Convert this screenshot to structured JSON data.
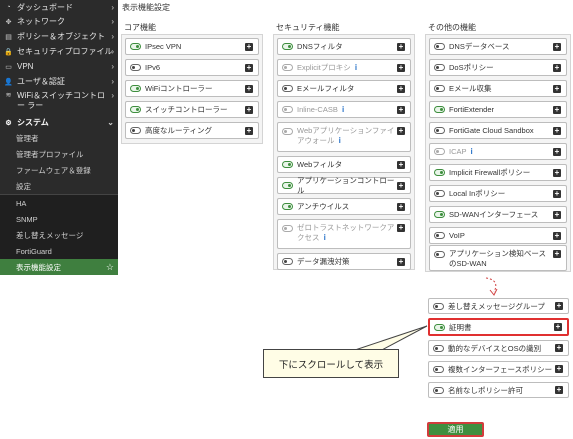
{
  "sidebar": {
    "items": [
      {
        "icon": "dashboard-icon",
        "glyph": "◔",
        "label": "ダッシュボード"
      },
      {
        "icon": "network-icon",
        "glyph": "✥",
        "label": "ネットワーク"
      },
      {
        "icon": "policy-icon",
        "glyph": "▤",
        "label": "ポリシー＆オブジェクト"
      },
      {
        "icon": "lock-icon",
        "glyph": "🔒",
        "label": "セキュリティプロファイル"
      },
      {
        "icon": "monitor-icon",
        "glyph": "▭",
        "label": "VPN"
      },
      {
        "icon": "user-icon",
        "glyph": "👤",
        "label": "ユーザ＆認証"
      },
      {
        "icon": "wifi-icon",
        "glyph": "≋",
        "label": "WiFi＆スイッチコントロー ラー"
      },
      {
        "icon": "gear-icon",
        "glyph": "⚙",
        "label": "システム"
      }
    ],
    "sub_items": [
      "管理者",
      "管理者プロファイル",
      "ファームウェア＆登録",
      "設定",
      "HA",
      "SNMP",
      "差し替えメッセージ",
      "FortiGuard",
      "表示機能設定"
    ]
  },
  "page_title": "表示機能設定",
  "columns": {
    "core": {
      "title": "コア機能",
      "items": [
        {
          "label": "IPsec VPN",
          "on": true
        },
        {
          "label": "IPv6",
          "on": false
        },
        {
          "label": "WiFiコントローラー",
          "on": true
        },
        {
          "label": "スイッチコントローラー",
          "on": true
        },
        {
          "label": "高度なルーティング",
          "on": false
        }
      ]
    },
    "security": {
      "title": "セキュリティ機能",
      "items": [
        {
          "label": "DNSフィルタ",
          "on": true
        },
        {
          "label": "Explicitプロキシ",
          "on": false,
          "disabled": true,
          "info": "i"
        },
        {
          "label": "Eメールフィルタ",
          "on": false
        },
        {
          "label": "Inline-CASB",
          "on": false,
          "disabled": true,
          "info": "i"
        },
        {
          "label": "Webアプリケーションファイアウォール",
          "on": false,
          "disabled": true,
          "info": "i"
        },
        {
          "label": "Webフィルタ",
          "on": true
        },
        {
          "label": "アプリケーションコントロール",
          "on": true
        },
        {
          "label": "アンチウイルス",
          "on": true
        },
        {
          "label": "ゼロトラストネットワークアクセス",
          "on": false,
          "disabled": true,
          "info": "i"
        },
        {
          "label": "データ漏洩対策",
          "on": false
        }
      ]
    },
    "other": {
      "title": "その他の機能",
      "items": [
        {
          "label": "DNSデータベース",
          "on": false
        },
        {
          "label": "DoSポリシー",
          "on": false
        },
        {
          "label": "Eメール収集",
          "on": false
        },
        {
          "label": "FortiExtender",
          "on": true
        },
        {
          "label": "FortiGate Cloud Sandbox",
          "on": false
        },
        {
          "label": "ICAP",
          "on": false,
          "disabled": true,
          "info": "i"
        },
        {
          "label": "Implicit Firewallポリシー",
          "on": true
        },
        {
          "label": "Local Inポリシー",
          "on": false
        },
        {
          "label": "SD-WANインターフェース",
          "on": true
        },
        {
          "label": "VoIP",
          "on": false
        },
        {
          "label": "アプリケーション検知ベースのSD-WAN",
          "on": false
        }
      ]
    }
  },
  "lower_items": [
    {
      "label": "差し替えメッセージグループ",
      "on": false
    },
    {
      "label": "証明書",
      "on": true
    },
    {
      "label": "動的なデバイスとOSの識別",
      "on": false
    },
    {
      "label": "複数インターフェースポリシー",
      "on": false
    },
    {
      "label": "名前なしポリシー許可",
      "on": false
    }
  ],
  "callout_text": "下にスクロールして表示",
  "apply_label": "適用",
  "icons": {
    "plus": "+",
    "star": "☆",
    "chevron_right": "›",
    "chevron_down": "⌄"
  },
  "colors": {
    "accent": "#3f8f3f",
    "highlight": "#e03030",
    "info": "#2a74c9"
  }
}
